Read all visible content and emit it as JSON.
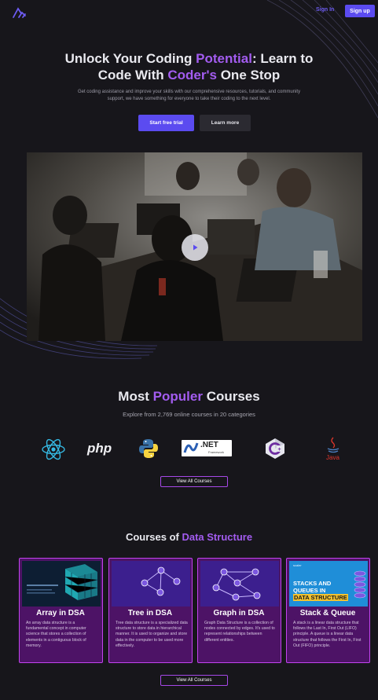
{
  "nav": {
    "signin": "Sign In",
    "signup": "Sign up",
    "logo_icon": "wave-logo-icon"
  },
  "hero": {
    "title_a": "Unlock Your Coding ",
    "title_b": "Potential",
    "title_c": ": Learn to",
    "title_d": "Code With ",
    "title_e": "Coder's",
    "title_f": " One Stop",
    "subtitle": "Get coding assistance and improve your skills with our comprehensive resources, tutorials, and community support, we have something for everyone to take their coding to the next level.",
    "btn_trial": "Start free trial",
    "btn_learn": "Learn more"
  },
  "video": {
    "play_icon": "play-icon"
  },
  "popular": {
    "title_a": "Most ",
    "title_b": "Populer",
    "title_c": " Courses",
    "subtitle": "Explore from 2,769 online courses in 20 categories",
    "logos": {
      "php": "php",
      "net": ".NET",
      "net_small": "Framework",
      "java": "Java"
    },
    "view_all": "View All Courses"
  },
  "ds": {
    "title_a": "Courses of ",
    "title_b": "Data Structure",
    "cards": [
      {
        "title": "Array in DSA",
        "desc": "An array data structure is a fundamental concept in computer science that stores a collection of elements in a contiguous block of memory."
      },
      {
        "title": "Tree in DSA",
        "desc": "Tree data structure is a specialized data structure to store data in hierarchical manner. It is used to organize and store data in the computer to be used more effectively."
      },
      {
        "title": "Graph in DSA",
        "desc": "Graph Data Structure is a collection of nodes connected by edges. It's used to represent relationships between different entities."
      },
      {
        "title": "Stack & Queue",
        "desc": "A stack is a linear data structure that follows the Last In, First Out (LIFO) principle. A queue is a linear data structure that follows the First In, First Out (FIFO) principle."
      }
    ],
    "stack_img": {
      "brand": "scaler",
      "l1": "STACKS AND",
      "l2": "QUEUES IN",
      "l3": "DATA STRUCTURE"
    },
    "view_all": "View All Courses"
  }
}
